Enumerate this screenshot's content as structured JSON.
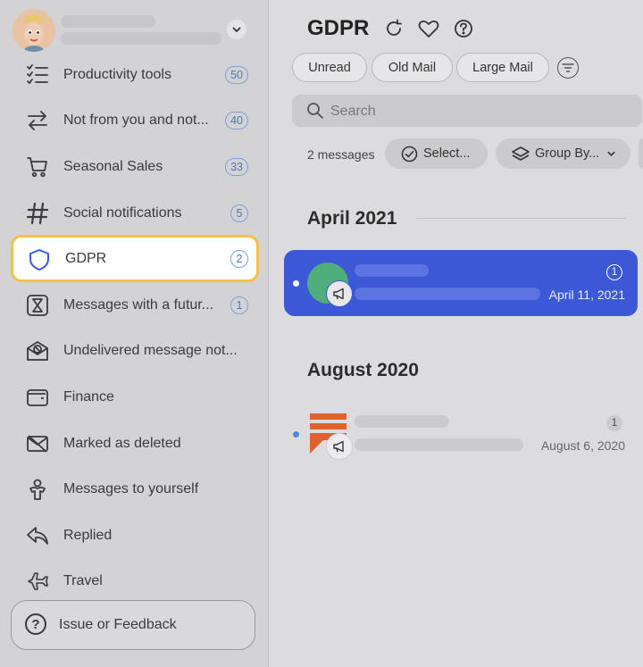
{
  "sidebar": {
    "items": [
      {
        "label": "Productivity tools",
        "badge": "50",
        "icon": "checklist-icon"
      },
      {
        "label": "Not from you and not...",
        "badge": "40",
        "icon": "arrows-swap-icon"
      },
      {
        "label": "Seasonal Sales",
        "badge": "33",
        "icon": "cart-icon"
      },
      {
        "label": "Social notifications",
        "badge": "5",
        "icon": "hashtag-icon"
      },
      {
        "label": "GDPR",
        "badge": "2",
        "icon": "shield-icon"
      },
      {
        "label": "Messages with a futur...",
        "badge": "1",
        "icon": "future-message-icon"
      },
      {
        "label": "Undelivered message not...",
        "badge": "",
        "icon": "undelivered-icon"
      },
      {
        "label": "Finance",
        "badge": "",
        "icon": "wallet-icon"
      },
      {
        "label": "Marked as deleted",
        "badge": "",
        "icon": "deleted-mail-icon"
      },
      {
        "label": "Messages to yourself",
        "badge": "",
        "icon": "self-icon"
      },
      {
        "label": "Replied",
        "badge": "",
        "icon": "reply-icon"
      },
      {
        "label": "Travel",
        "badge": "",
        "icon": "plane-icon"
      }
    ],
    "feedback_label": "Issue or Feedback"
  },
  "main": {
    "title": "GDPR",
    "chips": [
      "Unread",
      "Old Mail",
      "Large Mail"
    ],
    "search_placeholder": "Search",
    "message_count": "2 messages",
    "select_label": "Select...",
    "groupby_label": "Group By...",
    "groups": [
      {
        "heading": "April 2021",
        "messages": [
          {
            "date": "April 11, 2021",
            "badge": "1",
            "selected": true
          }
        ]
      },
      {
        "heading": "August 2020",
        "messages": [
          {
            "date": "August 6, 2020",
            "badge": "1",
            "selected": false
          }
        ]
      }
    ]
  },
  "colors": {
    "accent": "#3c58d6",
    "highlight_border": "#f5bf4a",
    "badge_blue": "#4e74b4"
  }
}
